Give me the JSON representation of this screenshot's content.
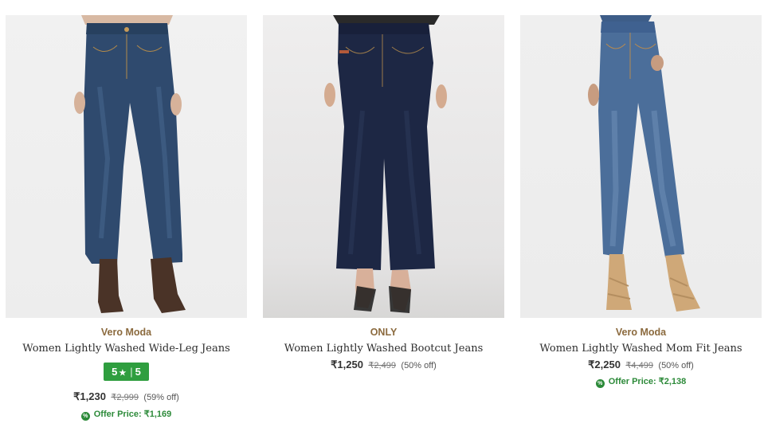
{
  "products": [
    {
      "brand": "Vero Moda",
      "title": "Women Lightly Washed Wide-Leg Jeans",
      "rating": {
        "stars": "5",
        "star_icon": "★",
        "separator": "|",
        "count": "5"
      },
      "price": "₹1,230",
      "mrp": "₹2,999",
      "discount": "(59% off)",
      "offer": "Offer Price: ₹1,169",
      "image_icon": "product-photo-wide-leg-jeans"
    },
    {
      "brand": "ONLY",
      "title": "Women Lightly Washed Bootcut Jeans",
      "price": "₹1,250",
      "mrp": "₹2,499",
      "discount": "(50% off)",
      "image_icon": "product-photo-bootcut-jeans"
    },
    {
      "brand": "Vero Moda",
      "title": "Women Lightly Washed Mom Fit Jeans",
      "price": "₹2,250",
      "mrp": "₹4,499",
      "discount": "(50% off)",
      "offer": "Offer Price: ₹2,138",
      "image_icon": "product-photo-mom-fit-jeans"
    }
  ],
  "colors": {
    "brand_text": "#8b6a3e",
    "rating_badge": "#2f9e3f",
    "offer_text": "#2c8a39"
  }
}
